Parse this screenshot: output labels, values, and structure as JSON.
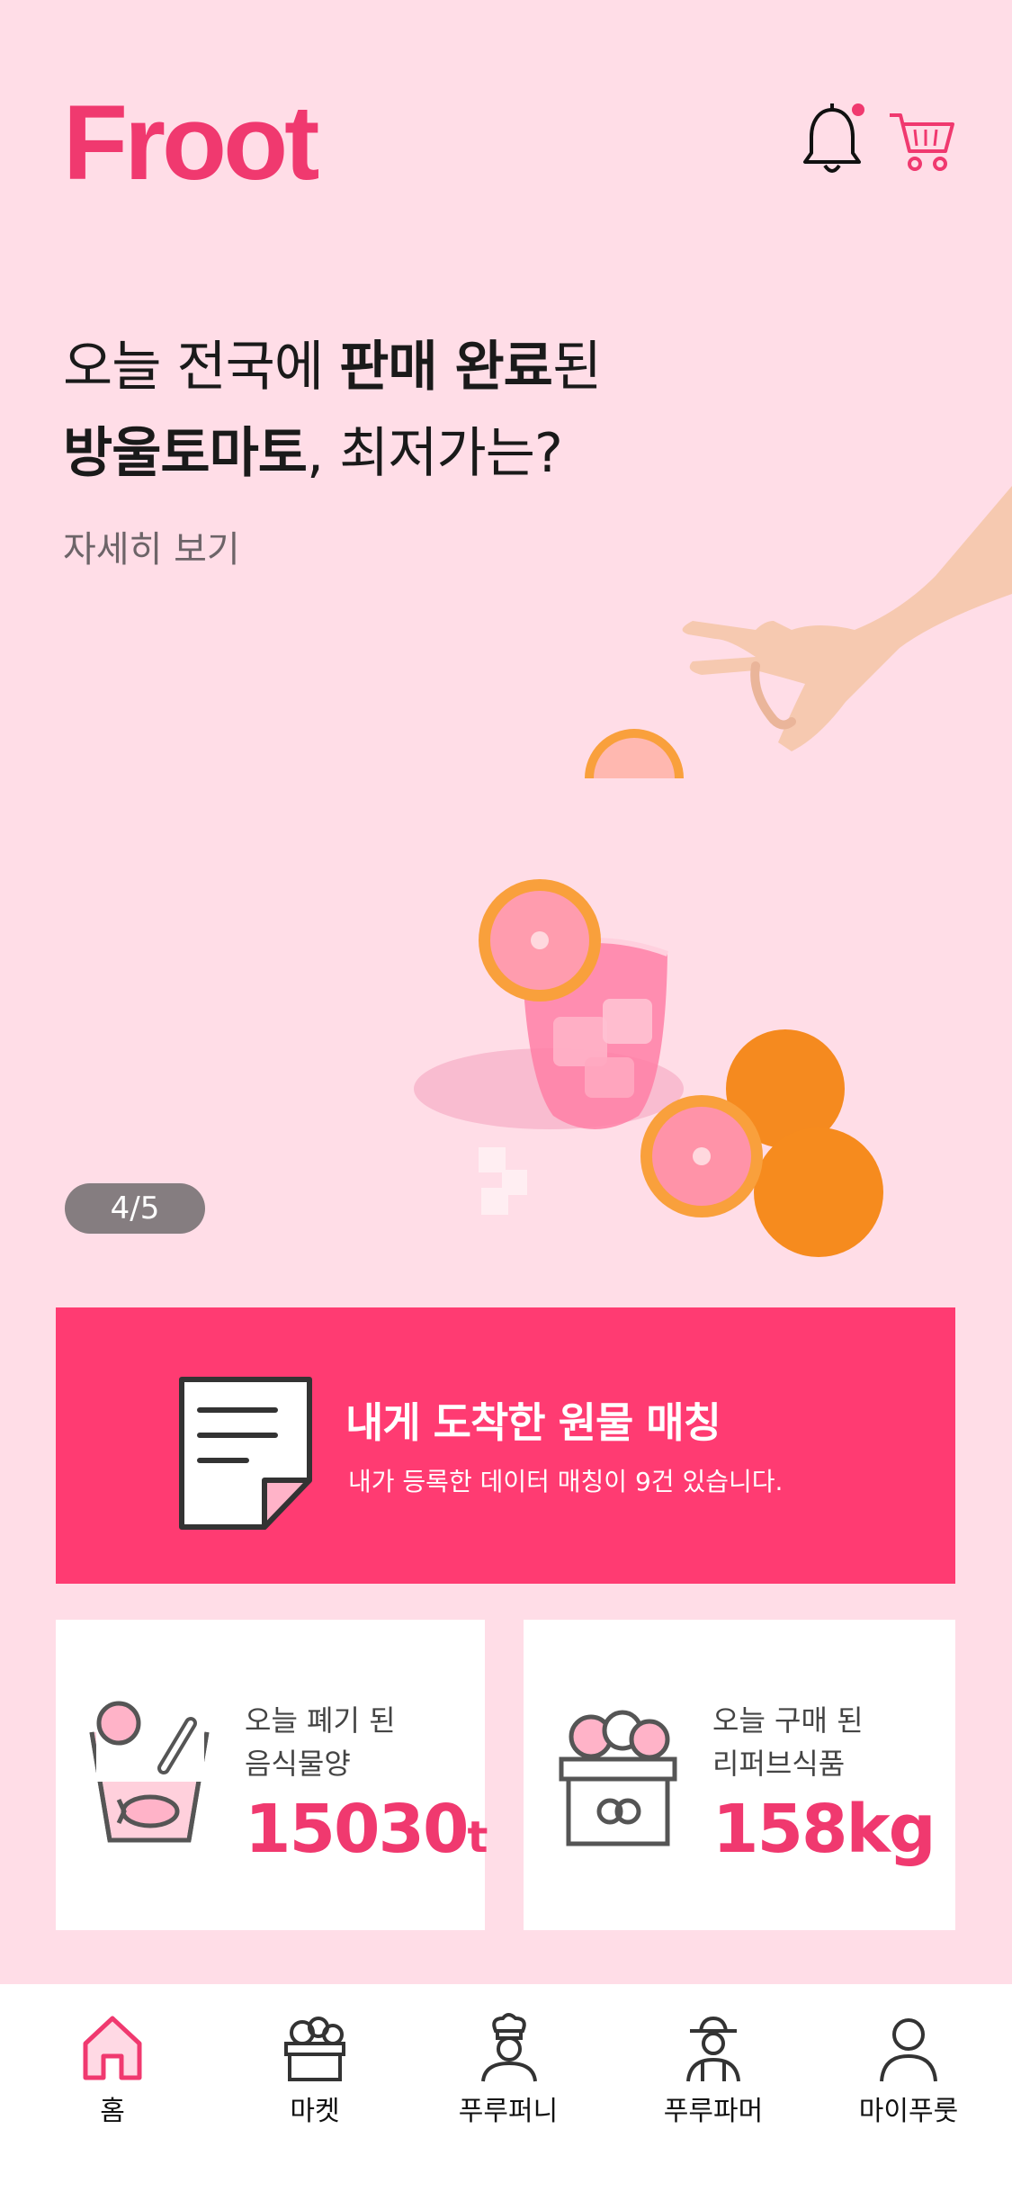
{
  "header": {
    "logo_text": "Froot",
    "bell_icon": "bell-icon",
    "cart_icon": "cart-icon",
    "brand_color": "#f0396f",
    "has_notification": true
  },
  "hero": {
    "line1_prefix": "오늘 전국에 ",
    "line1_bold": "판매 완료",
    "line1_suffix": "된",
    "line2_bold": "방울토마토",
    "line2_suffix": ", 최저가는?",
    "detail_link": "자세히 보기",
    "pager": "4/5"
  },
  "match": {
    "title": "내게 도착한 원물 매칭",
    "subtitle": "내가 등록한 데이터 매칭이 9건 있습니다.",
    "icon": "document-icon",
    "background": "#ff3b72"
  },
  "stats": {
    "waste": {
      "label": "오늘 폐기 된\n음식물양",
      "value": "15030",
      "unit": "t",
      "icon": "food-waste-icon"
    },
    "purchase": {
      "label": "오늘 구매 된\n리퍼브식품",
      "value": "158kg",
      "icon": "grocery-box-icon"
    }
  },
  "tabs": [
    {
      "label": "홈",
      "icon": "home-icon",
      "active": true
    },
    {
      "label": "마켓",
      "icon": "market-icon",
      "active": false
    },
    {
      "label": "푸루퍼니",
      "icon": "chef-icon",
      "active": false
    },
    {
      "label": "푸루파머",
      "icon": "farmer-icon",
      "active": false
    },
    {
      "label": "마이푸룻",
      "icon": "profile-icon",
      "active": false
    }
  ]
}
